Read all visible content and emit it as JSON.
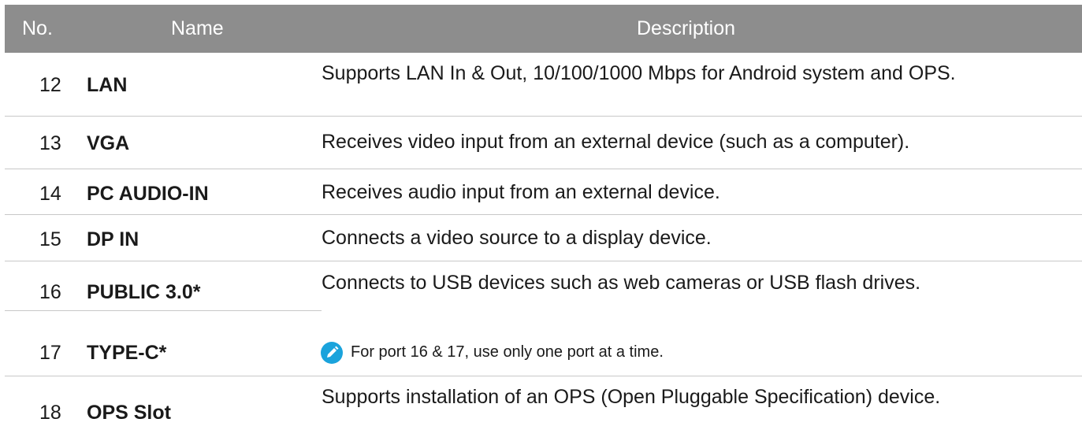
{
  "table": {
    "headers": {
      "no": "No.",
      "name": "Name",
      "description": "Description"
    },
    "rows": [
      {
        "no": "12",
        "name": "LAN",
        "description": "Supports LAN In & Out, 10/100/1000 Mbps for Android system and OPS."
      },
      {
        "no": "13",
        "name": "VGA",
        "description": "Receives video input from an external device (such as a computer)."
      },
      {
        "no": "14",
        "name": "PC AUDIO-IN",
        "description": "Receives audio input from an external device."
      },
      {
        "no": "15",
        "name": "DP IN",
        "description": "Connects a video source to a display device."
      },
      {
        "no": "16",
        "name": "PUBLIC 3.0*",
        "description": "Connects to USB devices such as web cameras or USB flash drives."
      },
      {
        "no": "17",
        "name": "TYPE-C*"
      },
      {
        "no": "18",
        "name": "OPS Slot",
        "description": "Supports installation of an OPS (Open Pluggable Specification) device."
      }
    ],
    "note": {
      "icon": "pencil-icon",
      "text": "For port 16 & 17, use only one port at a time."
    }
  },
  "colors": {
    "header_bg": "#8d8d8d",
    "divider": "#c8c8c8",
    "note_icon": "#1aa3dc"
  }
}
